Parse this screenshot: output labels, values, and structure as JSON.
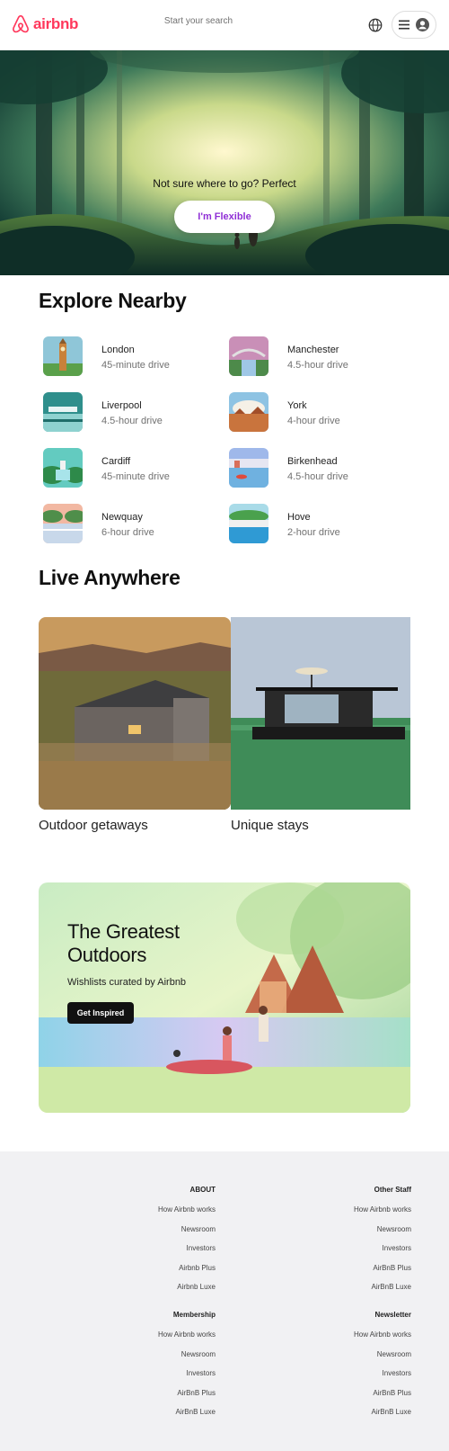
{
  "header": {
    "logo_text": "airbnb",
    "search_placeholder": "Start your search",
    "globe_icon": "globe-icon",
    "menu_icon": "hamburger-icon",
    "user_icon": "user-circle-icon"
  },
  "hero": {
    "text": "Not sure where to go? Perfect",
    "button_label": "I'm Flexible"
  },
  "explore": {
    "title": "Explore Nearby",
    "items": [
      {
        "name": "London",
        "distance": "45-minute drive"
      },
      {
        "name": "Manchester",
        "distance": "4.5-hour drive"
      },
      {
        "name": "Liverpool",
        "distance": "4.5-hour drive"
      },
      {
        "name": "York",
        "distance": "4-hour drive"
      },
      {
        "name": "Cardiff",
        "distance": "45-minute drive"
      },
      {
        "name": "Birkenhead",
        "distance": "4.5-hour drive"
      },
      {
        "name": "Newquay",
        "distance": "6-hour drive"
      },
      {
        "name": "Hove",
        "distance": "2-hour drive"
      }
    ]
  },
  "live": {
    "title": "Live Anywhere",
    "cards": [
      {
        "label": "Outdoor getaways"
      },
      {
        "label": "Unique stays"
      }
    ]
  },
  "outdoors": {
    "title_line1": "The Greatest",
    "title_line2": "Outdoors",
    "subtitle": "Wishlists curated by Airbnb",
    "button_label": "Get Inspired"
  },
  "footer": {
    "columns": [
      {
        "heading": "ABOUT",
        "links": [
          "How Airbnb works",
          "Newsroom",
          "Investors",
          "Airbnb Plus",
          "Airbnb Luxe"
        ]
      },
      {
        "heading": "Other Staff",
        "links": [
          "How Airbnb works",
          "Newsroom",
          "Investors",
          "AirBnB Plus",
          "AirBnB Luxe"
        ]
      },
      {
        "heading": "Membership",
        "links": [
          "How Airbnb works",
          "Newsroom",
          "Investors",
          "AirBnB Plus",
          "AirBnB Luxe"
        ]
      },
      {
        "heading": "Newsletter",
        "links": [
          "How Airbnb works",
          "Newsroom",
          "Investors",
          "AirBnB Plus",
          "AirBnB Luxe"
        ]
      }
    ]
  },
  "colors": {
    "brand": "#ff385c",
    "flexible_button_text": "#8f2fd6",
    "footer_bg": "#f1f1f3"
  }
}
